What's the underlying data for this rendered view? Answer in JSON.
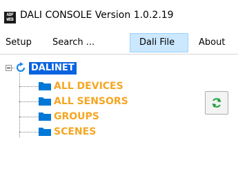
{
  "window": {
    "title": "DALI CONSOLE Version 1.0.2.19",
    "app_icon_lines": [
      "ADF",
      "WEB"
    ]
  },
  "menu": {
    "setup": "Setup",
    "search": "Search ...",
    "dali_file": "Dali File",
    "about": "About"
  },
  "tree": {
    "root": {
      "label": "DALINET",
      "icon": "refresh-icon",
      "expanded": true
    },
    "children": [
      {
        "label": "ALL DEVICES",
        "icon": "folder-icon"
      },
      {
        "label": "ALL SENSORS",
        "icon": "folder-icon"
      },
      {
        "label": "GROUPS",
        "icon": "folder-icon"
      },
      {
        "label": "SCENES",
        "icon": "folder-icon"
      }
    ]
  },
  "refresh_button": {
    "icon": "refresh-icon"
  },
  "colors": {
    "root_highlight": "#0a63e0",
    "folder_label": "#f5a623",
    "folder_icon": "#0078d7",
    "menu_selected_bg": "#cce8ff",
    "refresh_green": "#1f9e3a"
  }
}
